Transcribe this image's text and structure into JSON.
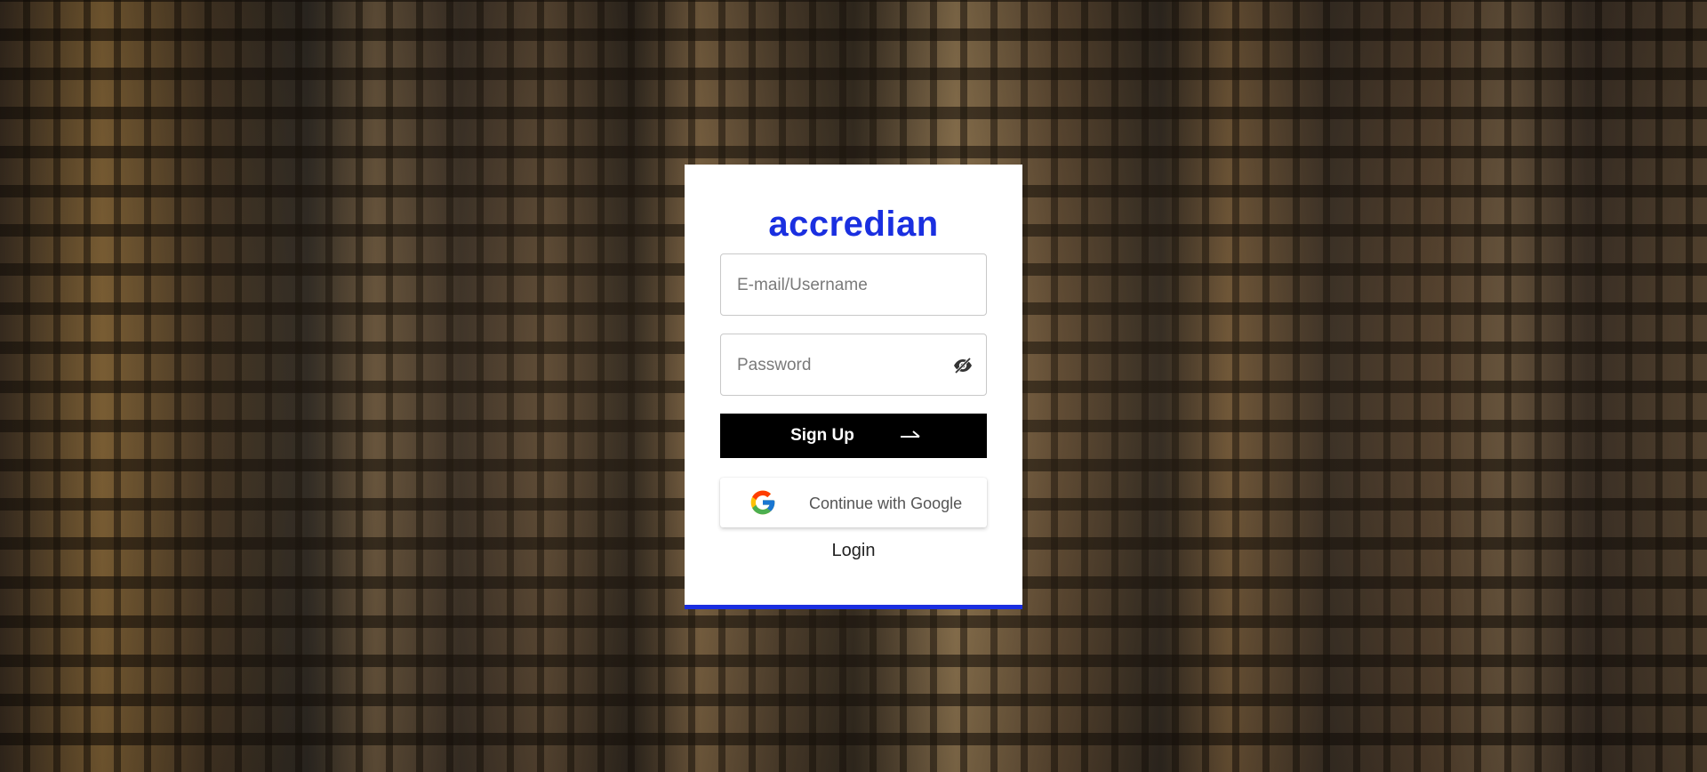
{
  "brand": {
    "name": "accredian",
    "color": "#1a2fe0"
  },
  "form": {
    "email_placeholder": "E-mail/Username",
    "email_value": "",
    "password_placeholder": "Password",
    "password_value": "",
    "password_toggle_icon": "eye-off-icon",
    "signup_label": "Sign Up",
    "signup_icon": "arrow-right-icon",
    "google_label": "Continue with Google",
    "google_icon": "google-icon",
    "login_label": "Login"
  },
  "colors": {
    "accent": "#1a2ee0",
    "button_bg": "#000000",
    "button_text": "#ffffff"
  }
}
